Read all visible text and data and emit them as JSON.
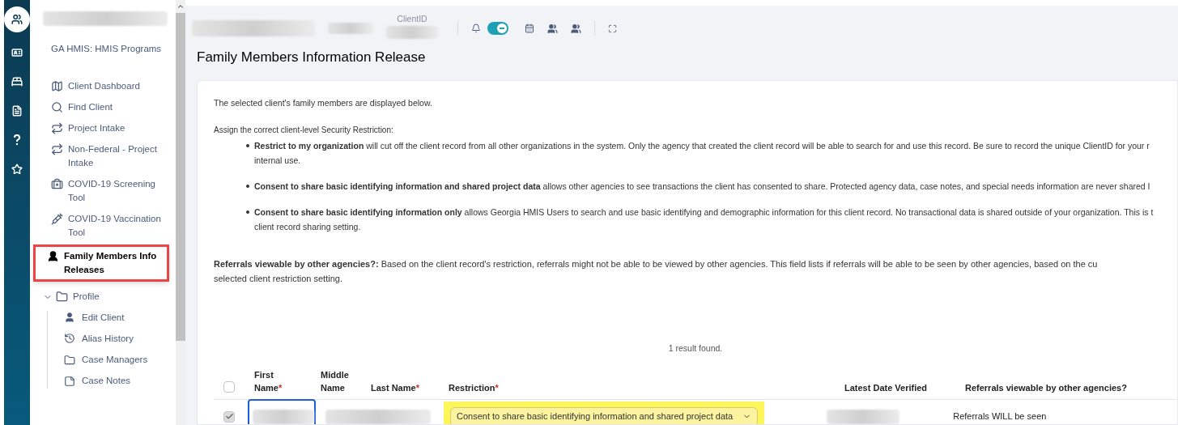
{
  "rail": {
    "items": [
      {
        "selected": true
      },
      {
        "selected": false
      },
      {
        "selected": false
      },
      {
        "selected": false
      },
      {
        "selected": false
      },
      {
        "selected": false
      }
    ]
  },
  "sidebar": {
    "program": "GA HMIS: HMIS Programs",
    "items": [
      {
        "label": "Client Dashboard",
        "selected": false
      },
      {
        "label": "Find Client",
        "selected": false
      },
      {
        "label": "Project Intake",
        "selected": false
      },
      {
        "label": "Non-Federal - Project Intake",
        "selected": false
      },
      {
        "label": "COVID-19 Screening Tool",
        "selected": false
      },
      {
        "label": "COVID-19 Vaccination Tool",
        "selected": false
      },
      {
        "label": "Family Members Info Releases",
        "selected": true
      }
    ],
    "folder": {
      "label": "Profile",
      "expanded": true,
      "children": [
        {
          "label": "Edit Client"
        },
        {
          "label": "Alias History"
        },
        {
          "label": "Case Managers"
        },
        {
          "label": "Case Notes"
        }
      ]
    }
  },
  "header": {
    "client_id_label": "ClientID",
    "alerts_on": true
  },
  "page_title": "Family Members Information Release",
  "intro": "The selected client's family members are displayed below.",
  "restriction_heading": "Assign the correct client-level Security Restriction:",
  "bullets": [
    {
      "lines": [
        "**Restrict to my organization** will cut off the client record from all other organizations in the system.  Only the agency that created the client record will be able to search for and use this record.  Be sure to record the unique ClientID for your r",
        "internal use."
      ]
    },
    {
      "lines": [
        "**Consent to share basic identifying information and shared project data** allows other agencies to see transactions the client has consented to share.  Protected agency data, case notes, and special needs information are never shared I"
      ]
    },
    {
      "lines": [
        "**Consent to share basic identifying information only** allows Georgia HMIS Users to search and use basic identifying and demographic information for this client record. No transactional data is shared outside of your organization.  This is t",
        "client record sharing setting."
      ]
    }
  ],
  "referrals_note": {
    "lines": [
      "**Referrals viewable by other agencies?:**  Based on the client record's restriction, referrals might not be able to be viewed by other agencies.  This field lists if referrals will be able to be seen by other agencies, based on the cu",
      "selected client restriction setting."
    ]
  },
  "result_count": "1 result found.",
  "table": {
    "select_all": {
      "checked": false
    },
    "columns": [
      {
        "label": "First Name",
        "required_mark": "*"
      },
      {
        "label": "Middle Name"
      },
      {
        "label": "Last Name",
        "required_mark": "*"
      },
      {
        "label": "Restriction",
        "required_mark": "*"
      },
      {
        "label": "Latest Date Verified"
      },
      {
        "label": "Referrals viewable by other agencies?"
      }
    ],
    "rows": [
      {
        "checked": true,
        "restriction": "Consent to share basic identifying information and shared project data",
        "referrals": "Referrals WILL be seen"
      }
    ]
  }
}
